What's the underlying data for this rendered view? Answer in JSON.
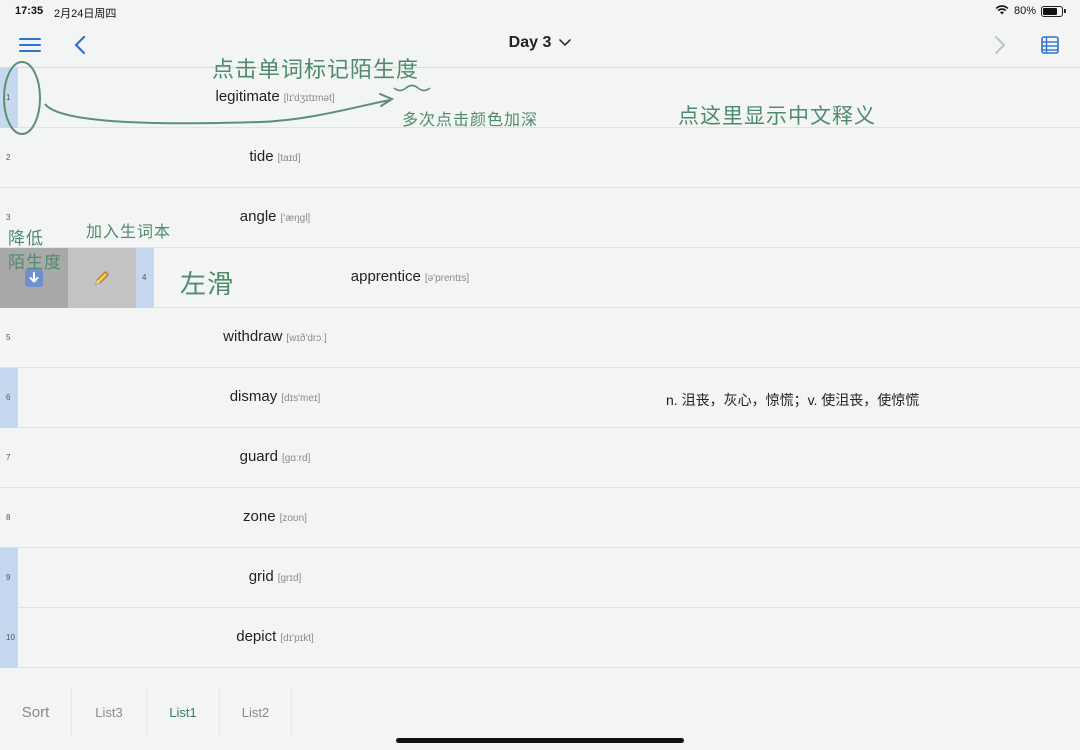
{
  "status": {
    "time": "17:35",
    "date": "2月24日周四",
    "battery": "80%",
    "battery_level": 0.8
  },
  "nav": {
    "title": "Day 3",
    "accent": "#2f73c9"
  },
  "rows": [
    {
      "num": "1",
      "word": "legitimate",
      "phonetic": "[lɪ'dʒɪtɪmət]",
      "highlighted": true
    },
    {
      "num": "2",
      "word": "tide",
      "phonetic": "[taɪd]",
      "highlighted": false
    },
    {
      "num": "3",
      "word": "angle",
      "phonetic": "['æŋgl]",
      "highlighted": false
    },
    {
      "num": "4",
      "word": "apprentice",
      "phonetic": "[ə'prentɪs]",
      "highlighted": true,
      "swiped": true
    },
    {
      "num": "5",
      "word": "withdraw",
      "phonetic": "[wɪð'drɔː]",
      "highlighted": false
    },
    {
      "num": "6",
      "word": "dismay",
      "phonetic": "[dɪs'meɪ]",
      "highlighted": true,
      "meaning": "n. 沮丧，灰心，惊慌；v. 使沮丧，使惊慌"
    },
    {
      "num": "7",
      "word": "guard",
      "phonetic": "[gɑːrd]",
      "highlighted": false
    },
    {
      "num": "8",
      "word": "zone",
      "phonetic": "[zoʊn]",
      "highlighted": false
    },
    {
      "num": "9",
      "word": "grid",
      "phonetic": "[grɪd]",
      "highlighted": true
    },
    {
      "num": "10",
      "word": "depict",
      "phonetic": "[dɪ'pɪkt]",
      "highlighted": true
    }
  ],
  "swipe_actions": {
    "lower_icon": "arrow-down-icon",
    "add_icon": "pencil-icon"
  },
  "tabs": {
    "sort": "Sort",
    "items": [
      "List3",
      "List1",
      "List2"
    ],
    "active": "List1",
    "active_color": "#3a7d66"
  },
  "annotations": {
    "tap_word": "点击单词标记陌生度",
    "multi_tap": "多次点击颜色加深",
    "tap_here": "点这里显示中文释义",
    "lower": "降低",
    "lower2": "陌生度",
    "add_vocab": "加入生词本",
    "swipe_left": "左滑",
    "ink_color": "#4f8a6c"
  }
}
